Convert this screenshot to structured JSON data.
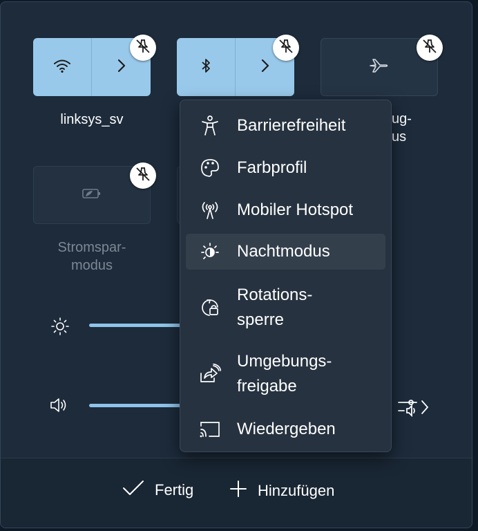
{
  "tiles": {
    "wifi": {
      "label": "linksys_sv",
      "icon": "wifi-icon",
      "state": "on"
    },
    "bluetooth": {
      "label": "",
      "icon": "bluetooth-icon",
      "state": "on"
    },
    "airplane": {
      "label_fragment_1": "ug-",
      "label_fragment_2": "us",
      "icon": "airplane-icon",
      "state": "off"
    },
    "battery_saver": {
      "label_line1": "Stromspar-",
      "label_line2": "modus",
      "icon": "battery-saver-icon",
      "state": "off"
    }
  },
  "menu": {
    "items": [
      {
        "label": "Barrierefreiheit",
        "icon": "accessibility-icon"
      },
      {
        "label": "Farbprofil",
        "icon": "palette-icon"
      },
      {
        "label": "Mobiler Hotspot",
        "icon": "hotspot-icon"
      },
      {
        "label": "Nachtmodus",
        "icon": "night-light-icon",
        "highlighted": true
      },
      {
        "label_line1": "Rotations-",
        "label_line2": "sperre",
        "icon": "rotation-lock-icon"
      },
      {
        "label_line1": "Umgebungs-",
        "label_line2": "freigabe",
        "icon": "nearby-share-icon"
      },
      {
        "label": "Wiedergeben",
        "icon": "cast-icon"
      }
    ]
  },
  "sliders": {
    "brightness": {
      "icon": "brightness-icon"
    },
    "volume": {
      "icon": "speaker-icon",
      "mixer_icon": "audio-mixer-icon"
    }
  },
  "footer": {
    "done_label": "Fertig",
    "add_label": "Hinzufügen"
  },
  "colors": {
    "accent": "#99c9ea",
    "panel": "#1d2b3b",
    "menu": "#26323f"
  }
}
